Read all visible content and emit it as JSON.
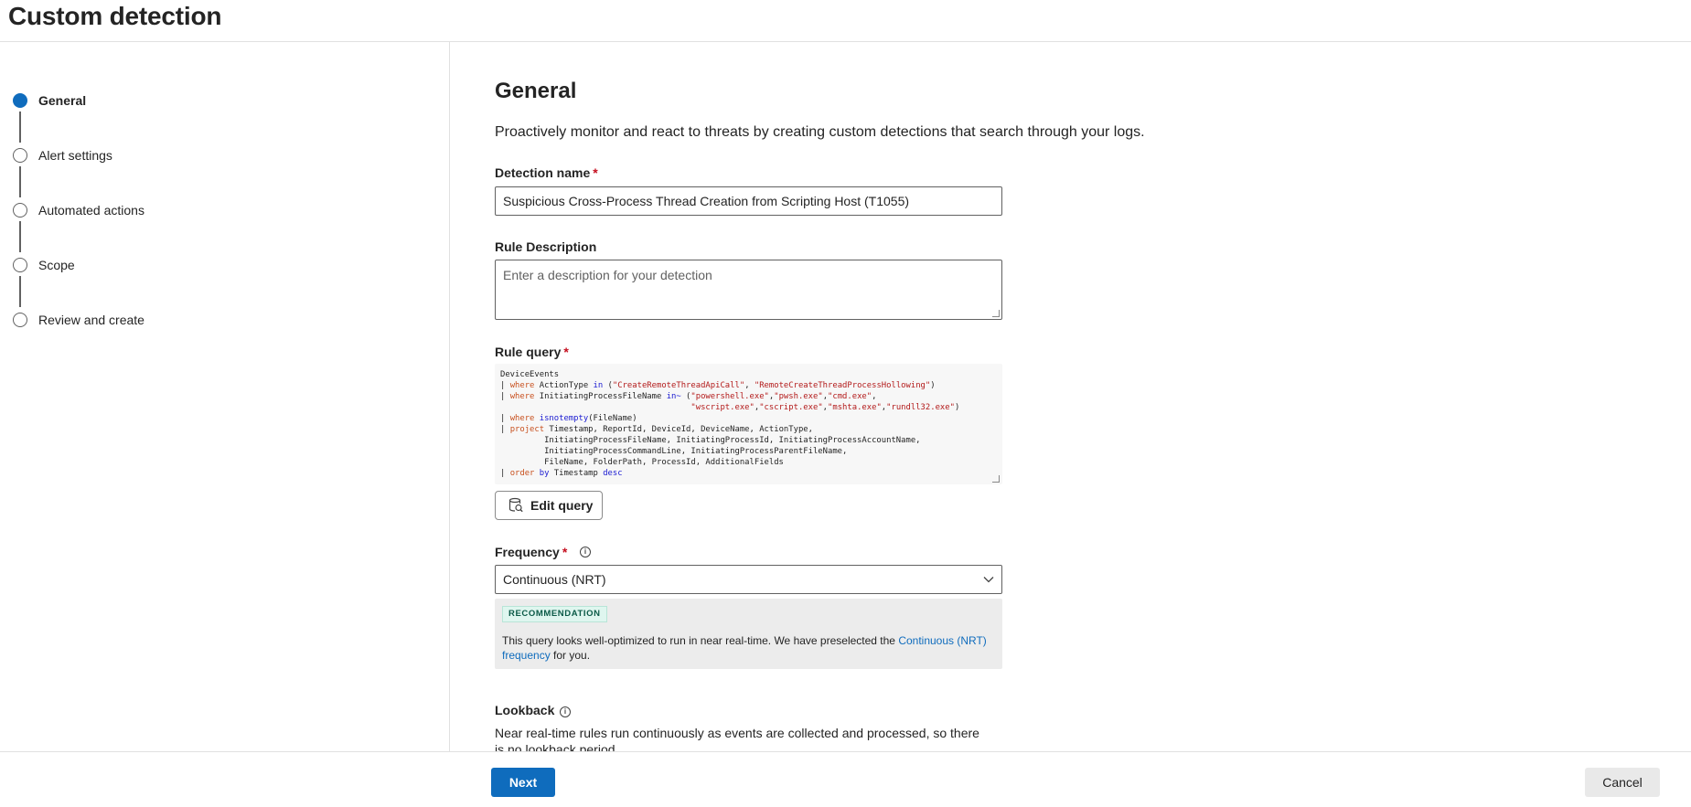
{
  "page": {
    "title": "Custom detection"
  },
  "wizard": {
    "steps": [
      {
        "label": "General",
        "state": "active"
      },
      {
        "label": "Alert settings",
        "state": "pending"
      },
      {
        "label": "Automated actions",
        "state": "pending"
      },
      {
        "label": "Scope",
        "state": "pending"
      },
      {
        "label": "Review and create",
        "state": "pending"
      }
    ]
  },
  "general": {
    "title": "General",
    "description": "Proactively monitor and react to threats by creating custom detections that search through your logs.",
    "detection_name": {
      "label": "Detection name",
      "required_mark": "*",
      "value": "Suspicious Cross-Process Thread Creation from Scripting Host (T1055)"
    },
    "rule_description": {
      "label": "Rule Description",
      "placeholder": "Enter a description for your detection",
      "value": ""
    },
    "rule_query": {
      "label": "Rule query",
      "required_mark": "*",
      "lines": [
        "DeviceEvents",
        "| where ActionType in (\"CreateRemoteThreadApiCall\", \"RemoteCreateThreadProcessHollowing\")",
        "| where InitiatingProcessFileName in~ (\"powershell.exe\",\"pwsh.exe\",\"cmd.exe\",",
        "                                       \"wscript.exe\",\"cscript.exe\",\"mshta.exe\",\"rundll32.exe\")",
        "| where isnotempty(FileName)",
        "| project Timestamp, ReportId, DeviceId, DeviceName, ActionType,",
        "         InitiatingProcessFileName, InitiatingProcessId, InitiatingProcessAccountName,",
        "         InitiatingProcessCommandLine, InitiatingProcessParentFileName,",
        "         FileName, FolderPath, ProcessId, AdditionalFields",
        "| order by Timestamp desc"
      ],
      "edit_button_label": "Edit query",
      "edit_button_icon": "edit-query-icon"
    },
    "frequency": {
      "label": "Frequency",
      "required_mark": "*",
      "info_icon": "info-icon",
      "selected": "Continuous (NRT)",
      "recommendation": {
        "badge": "RECOMMENDATION",
        "text_before": "This query looks well-optimized to run in near real-time. We have preselected the ",
        "link_text": "Continuous (NRT) frequency",
        "text_after": " for you."
      }
    },
    "lookback": {
      "label": "Lookback",
      "info_icon": "info-icon",
      "text": "Near real-time rules run continuously as events are collected and processed, so there is no lookback period."
    }
  },
  "footer": {
    "next_label": "Next",
    "cancel_label": "Cancel"
  },
  "colors": {
    "accent": "#0f6cbd",
    "required": "#c50f1f",
    "recommendation_bg": "#ececec",
    "badge_bg": "#dff6ef"
  }
}
